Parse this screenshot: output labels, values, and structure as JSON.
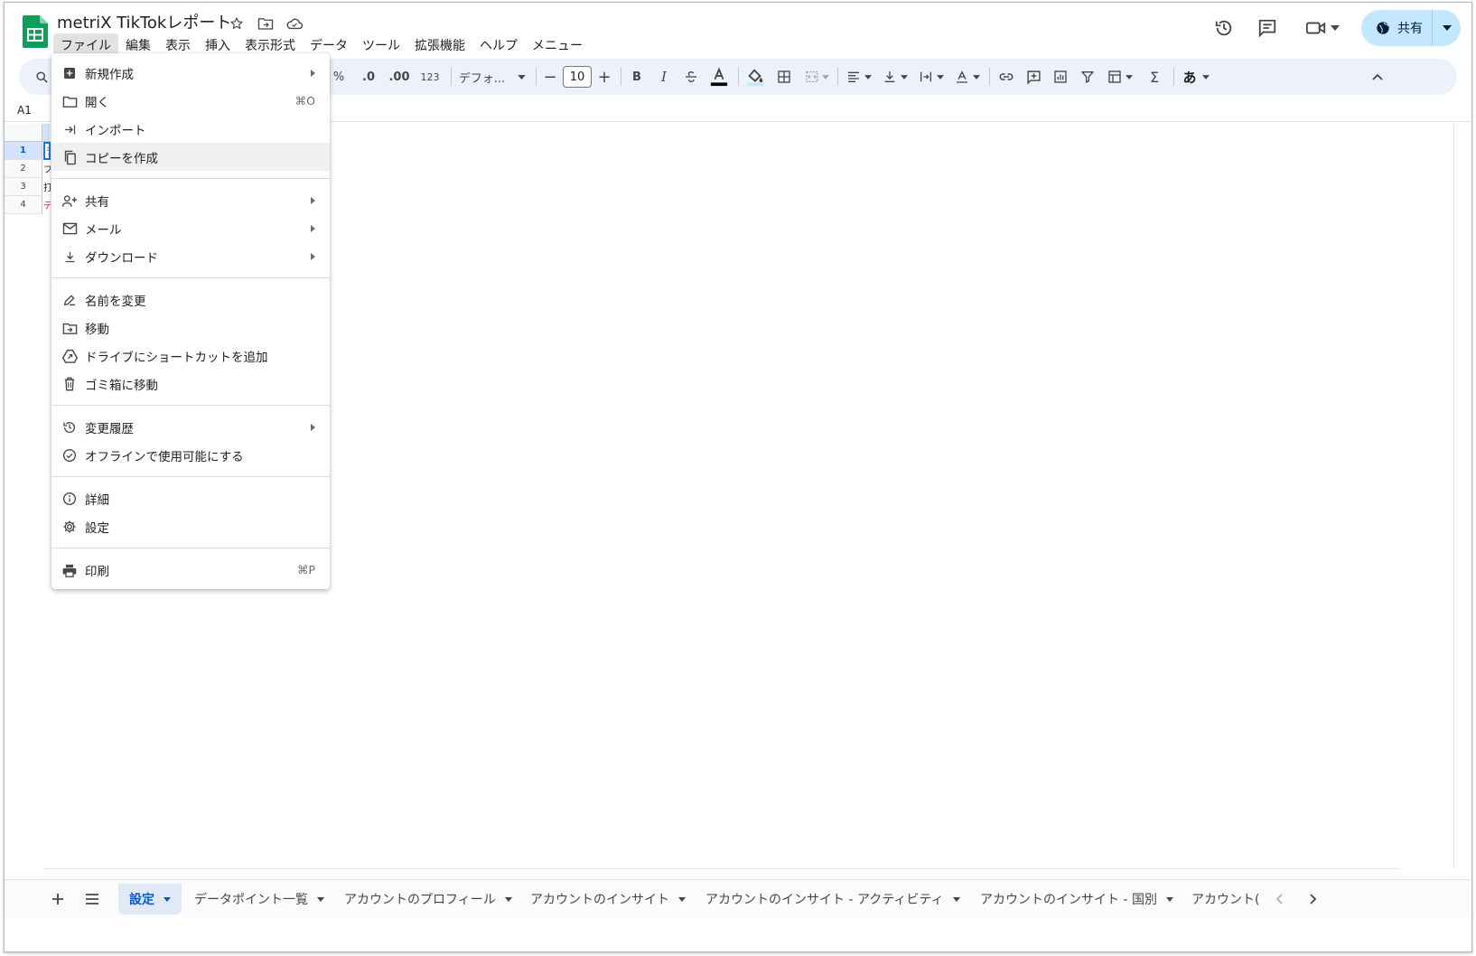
{
  "doc": {
    "title": "metriX TikTokレポート"
  },
  "menubar": [
    "ファイル",
    "編集",
    "表示",
    "挿入",
    "表示形式",
    "データ",
    "ツール",
    "拡張機能",
    "ヘルプ",
    "メニュー"
  ],
  "header": {
    "share_label": "共有"
  },
  "toolbar": {
    "percent": "%",
    "dec_decrease": ".0",
    "dec_increase": ".00",
    "number_format": "123",
    "font_name": "デフォ...",
    "font_size": "10",
    "bold": "B",
    "italic": "I",
    "input_method": "あ"
  },
  "namebox": "A1",
  "grid": {
    "rows": [
      "1",
      "2",
      "3",
      "4"
    ],
    "cells": [
      "ラ",
      "フ",
      "打",
      "テ"
    ]
  },
  "file_menu": {
    "groups": [
      [
        {
          "label": "新規作成",
          "icon": "add-box-icon",
          "submenu": true
        },
        {
          "label": "開く",
          "icon": "folder-icon",
          "shortcut": "⌘O"
        },
        {
          "label": "インポート",
          "icon": "import-icon"
        },
        {
          "label": "コピーを作成",
          "icon": "copy-icon",
          "hover": true
        }
      ],
      [
        {
          "label": "共有",
          "icon": "person-add-icon",
          "submenu": true
        },
        {
          "label": "メール",
          "icon": "mail-icon",
          "submenu": true
        },
        {
          "label": "ダウンロード",
          "icon": "download-icon",
          "submenu": true
        }
      ],
      [
        {
          "label": "名前を変更",
          "icon": "rename-icon"
        },
        {
          "label": "移動",
          "icon": "move-folder-icon"
        },
        {
          "label": "ドライブにショートカットを追加",
          "icon": "drive-shortcut-icon"
        },
        {
          "label": "ゴミ箱に移動",
          "icon": "trash-icon"
        }
      ],
      [
        {
          "label": "変更履歴",
          "icon": "history-icon",
          "submenu": true
        },
        {
          "label": "オフラインで使用可能にする",
          "icon": "offline-icon"
        }
      ],
      [
        {
          "label": "詳細",
          "icon": "info-icon"
        },
        {
          "label": "設定",
          "icon": "gear-icon"
        }
      ],
      [
        {
          "label": "印刷",
          "icon": "print-icon",
          "shortcut": "⌘P"
        }
      ]
    ]
  },
  "sheets": [
    {
      "label": "設定",
      "active": true
    },
    {
      "label": "データポイント一覧"
    },
    {
      "label": "アカウントのプロフィール"
    },
    {
      "label": "アカウントのインサイト"
    },
    {
      "label": "アカウントのインサイト - アクティビティ"
    },
    {
      "label": "アカウントのインサイト - 国別"
    },
    {
      "label": "アカウント("
    }
  ],
  "colors": {
    "accent": "#0b57d0",
    "share_bg": "#c2e7ff",
    "toolbar_bg": "#edf2fa",
    "sheets_green": "#0f9d58"
  }
}
